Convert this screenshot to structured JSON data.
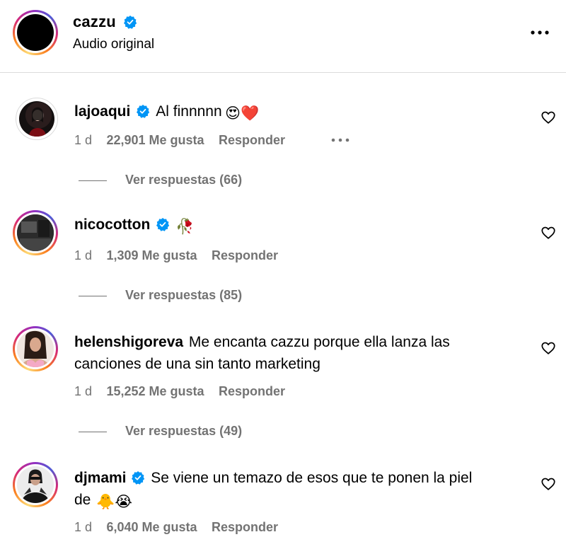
{
  "post": {
    "username": "cazzu",
    "subtitle": "Audio original",
    "verified": true
  },
  "icons": {
    "verified": "verified-badge-icon",
    "more": "more-options-icon",
    "heart": "heart-outline-icon"
  },
  "colors": {
    "verified_blue": "#0095f6",
    "meta_gray": "#737373",
    "divider": "#dbdbdb"
  },
  "comments": [
    {
      "username": "lajoaqui",
      "verified": true,
      "text": "Al finnnnn",
      "emojis": "😍❤️",
      "time": "1 d",
      "likes": "22,901 Me gusta",
      "reply_label": "Responder",
      "replies": "Ver respuestas (66)"
    },
    {
      "username": "nicocotton",
      "verified": true,
      "text": "",
      "emojis": "🥀",
      "time": "1 d",
      "likes": "1,309 Me gusta",
      "reply_label": "Responder",
      "replies": "Ver respuestas (85)"
    },
    {
      "username": "helenshigoreva",
      "verified": false,
      "text_line1": "Me encanta cazzu porque ella lanza las",
      "text_line2": "canciones de una sin tanto marketing",
      "time": "1 d",
      "likes": "15,252 Me gusta",
      "reply_label": "Responder",
      "replies": "Ver respuestas (49)"
    },
    {
      "username": "djmami",
      "verified": true,
      "text_line1": "Se viene un temazo de esos que te ponen la piel",
      "text_line2": "de",
      "emojis": "🐥😭",
      "time": "1 d",
      "likes": "6,040 Me gusta",
      "reply_label": "Responder"
    }
  ]
}
